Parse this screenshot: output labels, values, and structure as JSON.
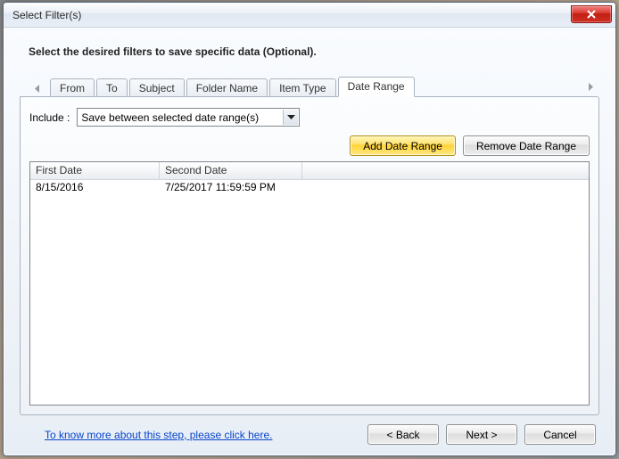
{
  "window": {
    "title": "Select Filter(s)"
  },
  "instruction": "Select the desired filters to save specific data (Optional).",
  "tabs": {
    "items": [
      {
        "label": "From"
      },
      {
        "label": "To"
      },
      {
        "label": "Subject"
      },
      {
        "label": "Folder Name"
      },
      {
        "label": "Item Type"
      },
      {
        "label": "Date Range"
      }
    ],
    "active_index": 5
  },
  "include": {
    "label": "Include :",
    "selected": "Save between selected date range(s)"
  },
  "buttons": {
    "add": "Add Date Range",
    "remove": "Remove Date Range"
  },
  "grid": {
    "headers": {
      "col1": "First Date",
      "col2": "Second Date"
    },
    "rows": [
      {
        "first_date": "8/15/2016",
        "second_date": "7/25/2017 11:59:59 PM"
      }
    ]
  },
  "footer": {
    "help": "To know more about this step, please click here.",
    "back": "< Back",
    "next": "Next >",
    "cancel": "Cancel"
  }
}
